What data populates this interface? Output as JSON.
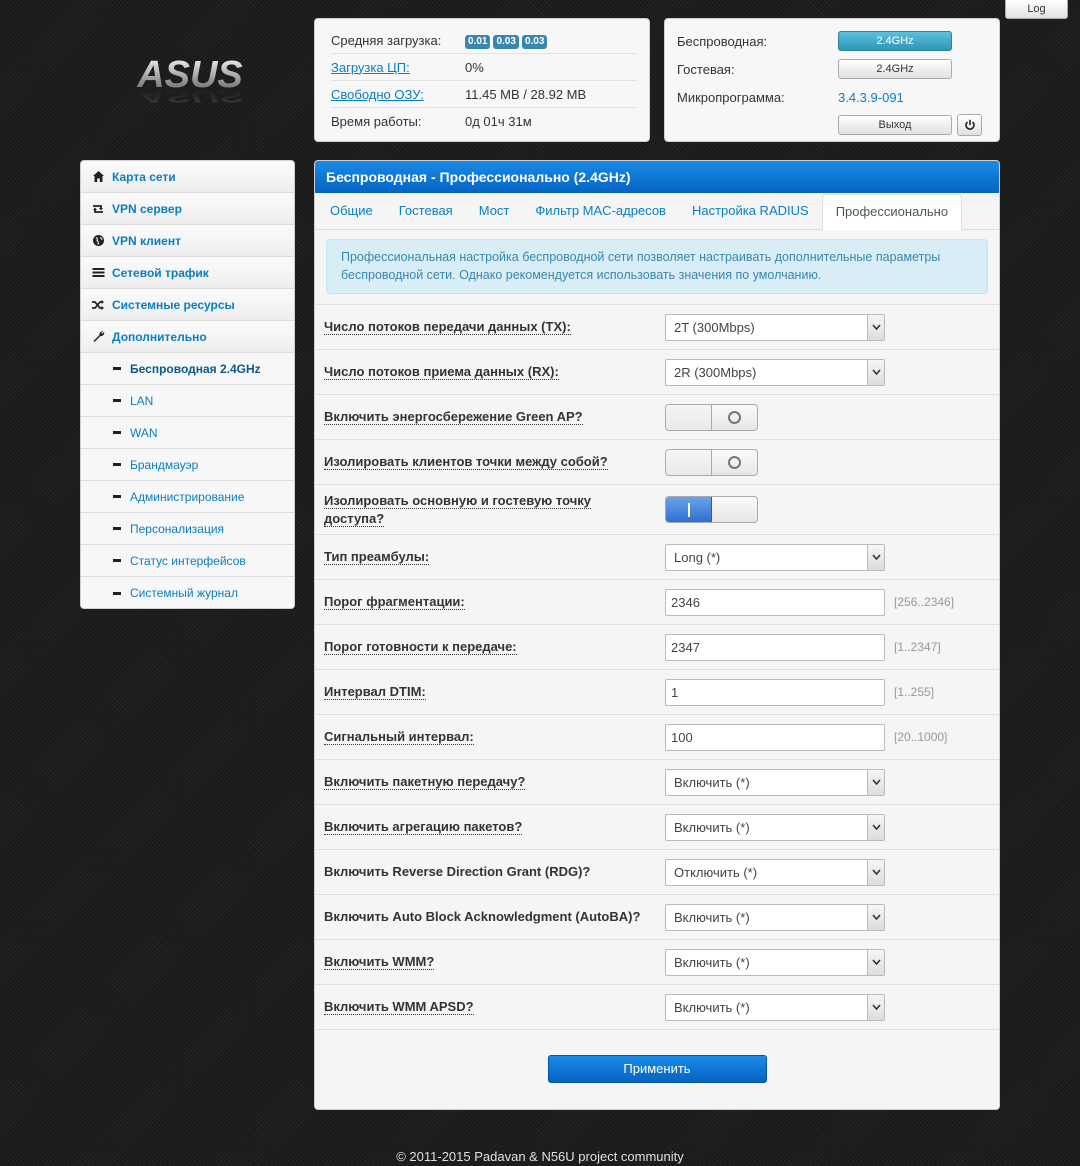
{
  "top": {
    "log_label": "Log"
  },
  "logo": {
    "text": "ASUS"
  },
  "stats": {
    "load_label": "Средняя загрузка:",
    "load_values": [
      "0.01",
      "0.03",
      "0.03"
    ],
    "cpu_label": "Загрузка ЦП:",
    "cpu_value": "0%",
    "ram_label": "Свободно ОЗУ:",
    "ram_value": "11.45 MB / 28.92 MB",
    "uptime_label": "Время работы:",
    "uptime_value": "0д 01ч 31м"
  },
  "wireless_panel": {
    "wireless_label": "Беспроводная:",
    "wireless_band": "2.4GHz",
    "guest_label": "Гостевая:",
    "guest_band": "2.4GHz",
    "firmware_label": "Микропрограмма:",
    "firmware_value": "3.4.3.9-091",
    "exit_label": "Выход",
    "power_icon": "power-icon"
  },
  "sidebar": {
    "items": [
      {
        "label": "Карта сети",
        "icon": "home-icon"
      },
      {
        "label": "VPN сервер",
        "icon": "retweet-icon"
      },
      {
        "label": "VPN клиент",
        "icon": "globe-icon"
      },
      {
        "label": "Сетевой трафик",
        "icon": "list-icon"
      },
      {
        "label": "Системные ресурсы",
        "icon": "random-icon"
      },
      {
        "label": "Дополнительно",
        "icon": "wrench-icon"
      }
    ],
    "subitems": [
      "Беспроводная 2.4GHz",
      "LAN",
      "WAN",
      "Брандмауэр",
      "Администрирование",
      "Персонализация",
      "Статус интерфейсов",
      "Системный журнал"
    ]
  },
  "main": {
    "title": "Беспроводная - Профессионально (2.4GHz)",
    "tabs": [
      "Общие",
      "Гостевая",
      "Мост",
      "Фильтр MAC-адресов",
      "Настройка RADIUS",
      "Профессионально"
    ],
    "info": "Профессиональная настройка беспроводной сети позволяет настраивать дополнительные параметры беспроводной сети. Однако рекомендуется использовать значения по умолчанию.",
    "rows": {
      "tx_label": "Число потоков передачи данных (TX):",
      "tx_value": "2T (300Mbps)",
      "rx_label": "Число потоков приема данных (RX):",
      "rx_value": "2R (300Mbps)",
      "greenap_label": "Включить энергосбережение Green AP?",
      "greenap_on": false,
      "isolate_label": "Изолировать клиентов точки между собой?",
      "isolate_on": false,
      "isolate_guest_label": "Изолировать основную и гостевую точку доступа?",
      "isolate_guest_on": true,
      "preamble_label": "Тип преамбулы:",
      "preamble_value": "Long (*)",
      "frag_label": "Порог фрагментации:",
      "frag_value": "2346",
      "frag_hint": "[256..2346]",
      "rts_label": "Порог готовности к передаче:",
      "rts_value": "2347",
      "rts_hint": "[1..2347]",
      "dtim_label": "Интервал DTIM:",
      "dtim_value": "1",
      "dtim_hint": "[1..255]",
      "beacon_label": "Сигнальный интервал:",
      "beacon_value": "100",
      "beacon_hint": "[20..1000]",
      "burst_label": "Включить пакетную передачу?",
      "burst_value": "Включить (*)",
      "aggr_label": "Включить агрегацию пакетов?",
      "aggr_value": "Включить (*)",
      "rdg_label": "Включить Reverse Direction Grant (RDG)?",
      "rdg_value": "Отключить (*)",
      "autoba_label": "Включить Auto Block Acknowledgment (AutoBA)?",
      "autoba_value": "Включить (*)",
      "wmm_label": "Включить WMM?",
      "wmm_value": "Включить (*)",
      "apsd_label": "Включить WMM APSD?",
      "apsd_value": "Включить (*)"
    },
    "apply_label": "Применить"
  },
  "footer": {
    "text": "© 2011-2015 Padavan & N56U project community"
  }
}
